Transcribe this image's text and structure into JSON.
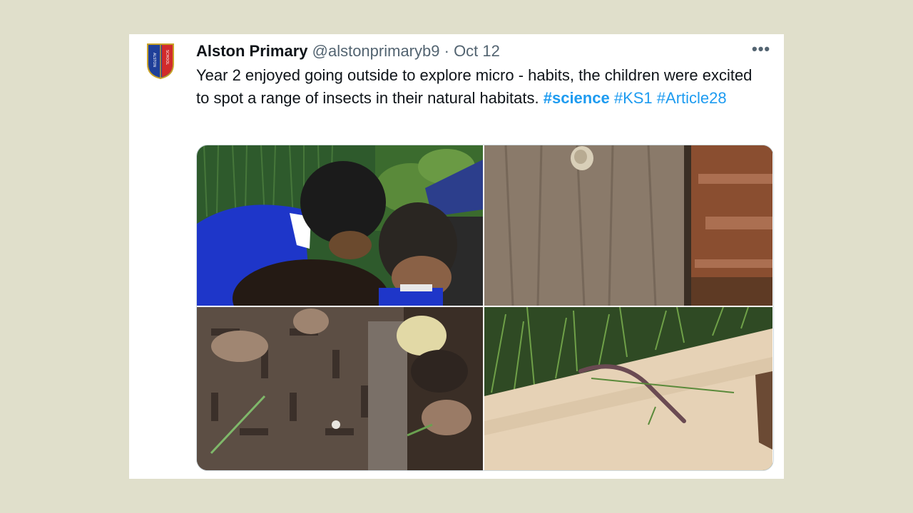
{
  "tweet": {
    "display_name": "Alston Primary",
    "handle": "@alstonprimaryb9",
    "separator": "·",
    "date": "Oct 12",
    "more_label": "•••",
    "text_main": "Year 2 enjoyed going outside to explore micro - habits, the children were excited to spot a range of insects in their natural habitats. ",
    "hashtags": [
      "#science",
      "#KS1",
      "#Article28"
    ],
    "avatar_letters_left": "ALSTON",
    "avatar_letters_right": "SCHOOL"
  },
  "colors": {
    "background": "#e0dfcb",
    "link": "#1d9bf0",
    "text": "#0f1419",
    "secondary": "#536471"
  },
  "media": {
    "photos": [
      {
        "subject": "children-looking-at-ground"
      },
      {
        "subject": "tree-trunk-with-snail"
      },
      {
        "subject": "drain-cover-with-rocks"
      },
      {
        "subject": "worm-on-log"
      }
    ]
  }
}
